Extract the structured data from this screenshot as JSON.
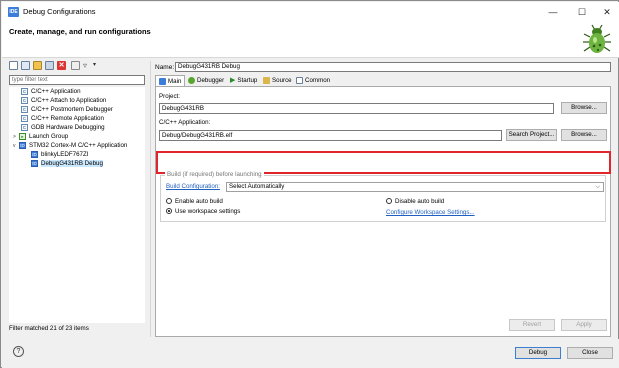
{
  "window": {
    "title": "Debug Configurations",
    "app_icon": "IDE",
    "minimize": "—",
    "maximize": "☐",
    "close": "✕"
  },
  "header": {
    "title": "Create, manage, and run configurations",
    "icon": "bug-icon"
  },
  "left": {
    "filter_placeholder": "type filter text",
    "tree": [
      {
        "label": "C/C++ Application",
        "icon": "c-icon",
        "level": 1
      },
      {
        "label": "C/C++ Attach to Application",
        "icon": "c-icon",
        "level": 1
      },
      {
        "label": "C/C++ Postmortem Debugger",
        "icon": "c-icon",
        "level": 1
      },
      {
        "label": "C/C++ Remote Application",
        "icon": "c-icon",
        "level": 1
      },
      {
        "label": "GDB Hardware Debugging",
        "icon": "c-icon",
        "level": 1
      },
      {
        "label": "Launch Group",
        "icon": "launch-group-icon",
        "level": 1,
        "twisty": ">"
      },
      {
        "label": "STM32 Cortex-M C/C++ Application",
        "icon": "ide-icon",
        "level": 1,
        "twisty": "v"
      },
      {
        "label": "blinkyLEDF767ZI",
        "icon": "ide-icon",
        "level": 2
      },
      {
        "label": "DebugG431RB Debug",
        "icon": "ide-icon",
        "level": 2,
        "selected": true
      }
    ],
    "status": "Filter matched 21 of 23 items"
  },
  "right": {
    "name_label": "Name:",
    "name_value": "DebugG431RB Debug",
    "tabs": [
      {
        "label": "Main",
        "active": true
      },
      {
        "label": "Debugger"
      },
      {
        "label": "Startup"
      },
      {
        "label": "Source"
      },
      {
        "label": "Common"
      }
    ],
    "project_label": "Project:",
    "project_value": "DebugG431RB",
    "browse1": "Browse...",
    "app_label": "C/C++ Application:",
    "app_value": "Debug/DebugG431RB.elf",
    "search_project": "Search Project...",
    "browse2": "Browse...",
    "group_legend": "Build (if required) before launching",
    "build_config_label": "Build Configuration:",
    "build_config_value": "Select Automatically",
    "enable_auto": "Enable auto build",
    "disable_auto": "Disable auto build",
    "use_workspace": "Use workspace settings",
    "configure_workspace": "Configure Workspace Settings...",
    "revert": "Revert",
    "apply": "Apply"
  },
  "footer": {
    "help": "?",
    "debug": "Debug",
    "close": "Close"
  }
}
